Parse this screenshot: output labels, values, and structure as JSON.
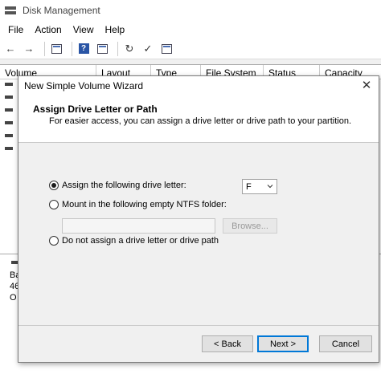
{
  "background_window": {
    "title": "Disk Management",
    "menu": [
      "File",
      "Action",
      "View",
      "Help"
    ],
    "toolbar_icons": [
      "back-arrow-icon",
      "forward-arrow-icon",
      "console-tree-icon",
      "help-icon",
      "properties-icon",
      "rescan-icon",
      "check-icon",
      "list-view-icon"
    ],
    "columns": [
      "Volume",
      "Layout",
      "Type",
      "File System",
      "Status",
      "Capacity"
    ],
    "bottom_partial_lines": [
      "Ba",
      "46",
      "O"
    ]
  },
  "wizard": {
    "title": "New Simple Volume Wizard",
    "heading": "Assign Drive Letter or Path",
    "subheading": "For easier access, you can assign a drive letter or drive path to your partition.",
    "options": {
      "assign_letter": "Assign the following drive letter:",
      "mount_folder": "Mount in the following empty NTFS folder:",
      "no_assign": "Do not assign a drive letter or drive path"
    },
    "selected_option": "assign_letter",
    "drive_letter": "F",
    "folder_path": "",
    "browse_label": "Browse...",
    "buttons": {
      "back": "< Back",
      "next": "Next >",
      "cancel": "Cancel"
    }
  }
}
